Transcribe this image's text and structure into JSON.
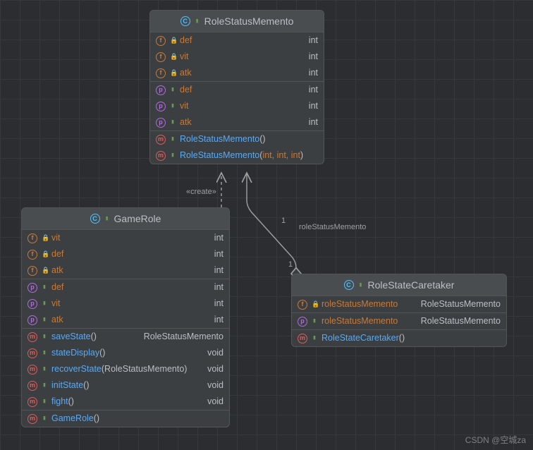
{
  "diagram": {
    "watermark": "CSDN @空城za",
    "relations": {
      "create_label": "«create»",
      "assoc_label": "roleStatusMemento",
      "mult_top": "1",
      "mult_bottom": "1"
    },
    "classes": {
      "memento": {
        "title": "RoleStatusMemento",
        "fields_private": [
          {
            "name": "def",
            "type": "int"
          },
          {
            "name": "vit",
            "type": "int"
          },
          {
            "name": "atk",
            "type": "int"
          }
        ],
        "props": [
          {
            "name": "def",
            "type": "int"
          },
          {
            "name": "vit",
            "type": "int"
          },
          {
            "name": "atk",
            "type": "int"
          }
        ],
        "methods": [
          {
            "name": "RoleStatusMemento",
            "params": "()"
          },
          {
            "name": "RoleStatusMemento",
            "params_prefix": "(",
            "params_mid": "int, int, int",
            "params_suffix": ")"
          }
        ]
      },
      "gamerole": {
        "title": "GameRole",
        "fields_private": [
          {
            "name": "vit",
            "type": "int"
          },
          {
            "name": "def",
            "type": "int"
          },
          {
            "name": "atk",
            "type": "int"
          }
        ],
        "props": [
          {
            "name": "def",
            "type": "int"
          },
          {
            "name": "vit",
            "type": "int"
          },
          {
            "name": "atk",
            "type": "int"
          }
        ],
        "methods": [
          {
            "name": "saveState",
            "params": "()",
            "ret": "RoleStatusMemento"
          },
          {
            "name": "stateDisplay",
            "params": "()",
            "ret": "void"
          },
          {
            "name": "recoverState",
            "params": "(RoleStatusMemento)",
            "ret": "void"
          },
          {
            "name": "initState",
            "params": "()",
            "ret": "void"
          },
          {
            "name": "fight",
            "params": "()",
            "ret": "void"
          }
        ],
        "ctor": {
          "name": "GameRole",
          "params": "()"
        }
      },
      "caretaker": {
        "title": "RoleStateCaretaker",
        "field_private": {
          "name": "roleStatusMemento",
          "type": "RoleStatusMemento"
        },
        "prop": {
          "name": "roleStatusMemento",
          "type": "RoleStatusMemento"
        },
        "ctor": {
          "name": "RoleStateCaretaker",
          "params": "()"
        }
      }
    }
  },
  "chart_data": {
    "type": "table",
    "title": "UML Class Diagram – Memento Pattern",
    "classes": [
      {
        "name": "RoleStatusMemento",
        "fields": [
          {
            "visibility": "private",
            "name": "def",
            "type": "int"
          },
          {
            "visibility": "private",
            "name": "vit",
            "type": "int"
          },
          {
            "visibility": "private",
            "name": "atk",
            "type": "int"
          }
        ],
        "properties": [
          {
            "visibility": "public",
            "name": "def",
            "type": "int"
          },
          {
            "visibility": "public",
            "name": "vit",
            "type": "int"
          },
          {
            "visibility": "public",
            "name": "atk",
            "type": "int"
          }
        ],
        "methods": [
          {
            "visibility": "public",
            "signature": "RoleStatusMemento()"
          },
          {
            "visibility": "public",
            "signature": "RoleStatusMemento(int, int, int)"
          }
        ]
      },
      {
        "name": "GameRole",
        "fields": [
          {
            "visibility": "private",
            "name": "vit",
            "type": "int"
          },
          {
            "visibility": "private",
            "name": "def",
            "type": "int"
          },
          {
            "visibility": "private",
            "name": "atk",
            "type": "int"
          }
        ],
        "properties": [
          {
            "visibility": "public",
            "name": "def",
            "type": "int"
          },
          {
            "visibility": "public",
            "name": "vit",
            "type": "int"
          },
          {
            "visibility": "public",
            "name": "atk",
            "type": "int"
          }
        ],
        "methods": [
          {
            "visibility": "public",
            "signature": "saveState()",
            "returns": "RoleStatusMemento"
          },
          {
            "visibility": "public",
            "signature": "stateDisplay()",
            "returns": "void"
          },
          {
            "visibility": "public",
            "signature": "recoverState(RoleStatusMemento)",
            "returns": "void"
          },
          {
            "visibility": "public",
            "signature": "initState()",
            "returns": "void"
          },
          {
            "visibility": "public",
            "signature": "fight()",
            "returns": "void"
          },
          {
            "visibility": "public",
            "signature": "GameRole()"
          }
        ]
      },
      {
        "name": "RoleStateCaretaker",
        "fields": [
          {
            "visibility": "private",
            "name": "roleStatusMemento",
            "type": "RoleStatusMemento"
          }
        ],
        "properties": [
          {
            "visibility": "public",
            "name": "roleStatusMemento",
            "type": "RoleStatusMemento"
          }
        ],
        "methods": [
          {
            "visibility": "public",
            "signature": "RoleStateCaretaker()"
          }
        ]
      }
    ],
    "relationships": [
      {
        "from": "GameRole",
        "to": "RoleStatusMemento",
        "type": "dependency",
        "label": "«create»"
      },
      {
        "from": "RoleStateCaretaker",
        "to": "RoleStatusMemento",
        "type": "association",
        "label": "roleStatusMemento",
        "multiplicity_source": "1",
        "multiplicity_target": "1"
      }
    ]
  }
}
